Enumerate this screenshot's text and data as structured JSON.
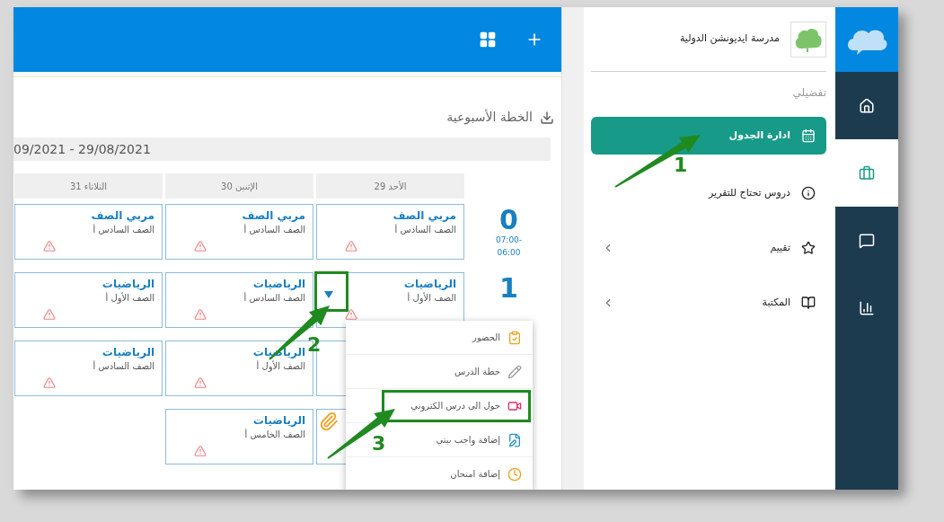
{
  "rail": [
    {
      "kind": "home",
      "selected": false
    },
    {
      "kind": "briefcase",
      "selected": true
    },
    {
      "kind": "chat",
      "selected": false
    },
    {
      "kind": "chart",
      "selected": false
    }
  ],
  "sidebar": {
    "school": "مدرسة ايديونشن الدولية",
    "section": "تفضيلي",
    "items": [
      {
        "label": "ادارة الجدول",
        "kind": "calendar",
        "selected": true,
        "expandable": false
      },
      {
        "label": "دروس تحتاج للتقرير",
        "kind": "info",
        "selected": false,
        "expandable": false
      },
      {
        "label": "تقييم",
        "kind": "star",
        "selected": false,
        "expandable": true
      },
      {
        "label": "المكتبة",
        "kind": "book",
        "selected": false,
        "expandable": true
      }
    ]
  },
  "plan": {
    "title": "الخطة الأسبوعية",
    "date_range": "09/2021 - 29/08/2021",
    "days": [
      "الأحد 29",
      "الإثنين 30",
      "الثلاثاء 31"
    ],
    "periods": [
      {
        "number": "0",
        "start": "-07:00",
        "end": "06:00"
      },
      {
        "number": "1"
      }
    ],
    "rows": [
      [
        {
          "kind": "lesson",
          "subject": "مربي الصف",
          "class": "الصف السادس أ"
        },
        {
          "kind": "lesson",
          "subject": "مربي الصف",
          "class": "الصف السادس أ"
        },
        {
          "kind": "lesson",
          "subject": "مربي الصف",
          "class": "الصف السادس أ"
        }
      ],
      [
        {
          "kind": "lesson",
          "subject": "الرياضيات",
          "class": "الصف الأول أ"
        },
        {
          "kind": "lesson",
          "subject": "الرياضيات",
          "class": "الصف السادس أ"
        },
        {
          "kind": "lesson",
          "subject": "الرياضيات",
          "class": "الصف الأول أ"
        }
      ],
      [
        {
          "kind": "covered"
        },
        {
          "kind": "lesson",
          "subject": "الرياضيات",
          "class": "الصف الأول أ"
        },
        {
          "kind": "lesson",
          "subject": "الرياضيات",
          "class": "الصف السادس أ"
        }
      ],
      [
        {
          "kind": "covered",
          "attachment": true
        },
        {
          "kind": "lesson",
          "subject": "الرياضيات",
          "class": "الصف الخامس أ"
        },
        {
          "kind": "none"
        }
      ]
    ]
  },
  "menu": [
    {
      "label": "الحضور",
      "kind": "clipboard"
    },
    {
      "label": "خطة الدرس",
      "kind": "pencil"
    },
    {
      "label": "حول الى درس الكتروني",
      "kind": "video"
    },
    {
      "label": "إضافة واجب بيتي",
      "kind": "file"
    },
    {
      "label": "إضافة امتحان",
      "kind": "clock"
    }
  ],
  "annotations": [
    "1",
    "2",
    "3"
  ]
}
